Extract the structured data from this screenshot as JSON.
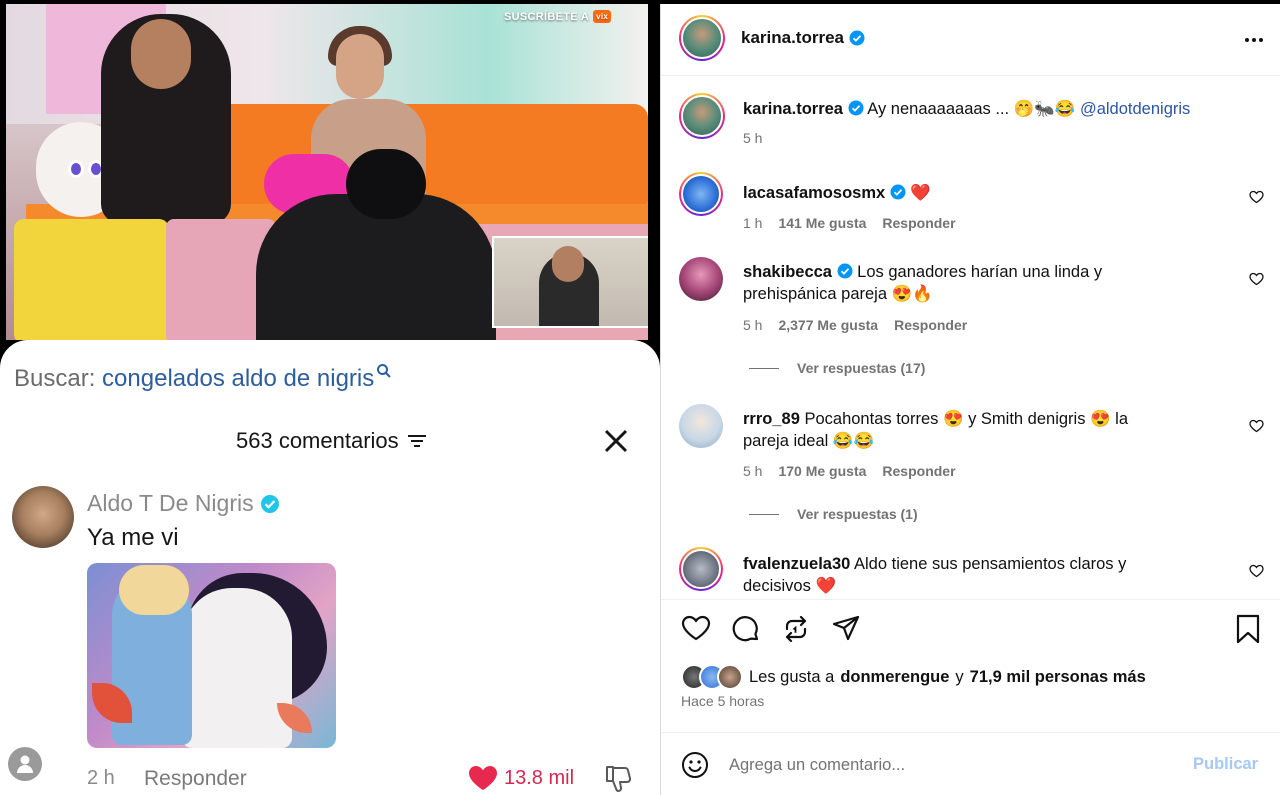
{
  "video": {
    "subscribe_label": "SUSCRÍBETE A",
    "brand": "vix"
  },
  "tiktok": {
    "search_prefix": "Buscar:",
    "search_query": "congelados aldo de nigris",
    "comments_count": "563 comentarios",
    "comment": {
      "author": "Aldo T De Nigris",
      "text": "Ya me vi",
      "time": "2 h",
      "reply_label": "Responder",
      "likes": "13.8 mil"
    }
  },
  "instagram": {
    "header": {
      "username": "karina.torrea"
    },
    "caption": {
      "username": "karina.torrea",
      "text": "Ay nenaaaaaaas ... 🤭🐜😂",
      "mention": "@aldotdenigris",
      "time": "5 h"
    },
    "comments": [
      {
        "username": "lacasafamososmx",
        "text": "❤️",
        "time": "1 h",
        "likes": "141 Me gusta",
        "reply": "Responder",
        "verified": true
      },
      {
        "username": "shakibecca",
        "text": "Los ganadores harían una linda y prehispánica pareja 😍🔥",
        "time": "5 h",
        "likes": "2,377 Me gusta",
        "reply": "Responder",
        "verified": true,
        "view_replies": "Ver respuestas (17)"
      },
      {
        "username": "rrro_89",
        "text": "Pocahontas torres 😍 y Smith denigris 😍 la pareja ideal 😂😂",
        "time": "5 h",
        "likes": "170 Me gusta",
        "reply": "Responder",
        "verified": false,
        "view_replies": "Ver respuestas (1)"
      },
      {
        "username": "fvalenzuela30",
        "text": "Aldo tiene sus pensamientos claros y decisivos ❤️",
        "verified": false
      }
    ],
    "likes_summary": {
      "prefix": "Les gusta a",
      "user": "donmerengue",
      "connector": "y",
      "others": "71,9 mil personas más"
    },
    "posted_ago": "Hace 5 horas",
    "composer": {
      "placeholder": "Agrega un comentario...",
      "publish_label": "Publicar"
    }
  },
  "colors": {
    "ig_link": "#2b55a5",
    "publish_disabled": "#a5c8f5",
    "verified": "#0095f6",
    "tiktok_like": "#d6284f"
  }
}
